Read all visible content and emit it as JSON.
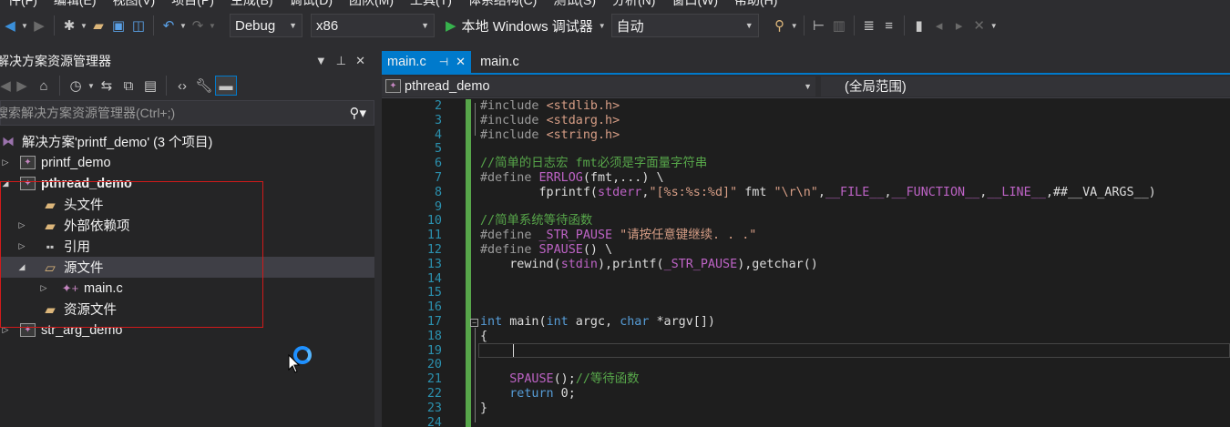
{
  "menu": [
    "件(F)",
    "编辑(E)",
    "视图(V)",
    "项目(P)",
    "生成(B)",
    "调试(D)",
    "团队(M)",
    "工具(T)",
    "体系结构(C)",
    "测试(S)",
    "分析(N)",
    "窗口(W)",
    "帮助(H)"
  ],
  "toolbar": {
    "config": "Debug",
    "platform": "x86",
    "debugger": "本地 Windows 调试器",
    "mode": "自动"
  },
  "solution_explorer": {
    "title": "解决方案资源管理器",
    "search_placeholder": "搜索解决方案资源管理器(Ctrl+;)",
    "tree": {
      "solution": "解决方案'printf_demo' (3 个项目)",
      "project1": "printf_demo",
      "project2": "pthread_demo",
      "headers": "头文件",
      "external": "外部依赖项",
      "refs": "引用",
      "sources": "源文件",
      "mainc": "main.c",
      "resources": "资源文件",
      "project3": "str_arg_demo"
    }
  },
  "editor": {
    "tabs": [
      "main.c",
      "main.c"
    ],
    "nav_project": "pthread_demo",
    "nav_scope": "(全局范围)",
    "line_numbers": [
      "2",
      "3",
      "4",
      "5",
      "6",
      "7",
      "8",
      "9",
      "10",
      "11",
      "12",
      "13",
      "14",
      "15",
      "16",
      "17",
      "18",
      "19",
      "20",
      "21",
      "22",
      "23",
      "24"
    ],
    "code": {
      "l2a": "#include ",
      "l2b": "<stdlib.h>",
      "l3a": "#include ",
      "l3b": "<stdarg.h>",
      "l4a": "#include ",
      "l4b": "<string.h>",
      "l6": "//简单的日志宏 fmt必须是字面量字符串",
      "l7a": "#define ",
      "l7b": "ERRLOG",
      "l7c": "(fmt,...) \\",
      "l8a": "        fprintf(",
      "l8b": "stderr",
      "l8c": ",",
      "l8d": "\"[%s:%s:%d]\"",
      "l8e": " fmt ",
      "l8f": "\"\\r\\n\"",
      "l8g": ",",
      "l8h": "__FILE__",
      "l8i": ",",
      "l8j": "__FUNCTION__",
      "l8k": ",",
      "l8l": "__LINE__",
      "l8m": ",##__VA_ARGS__)",
      "l10": "//简单系统等待函数",
      "l11a": "#define ",
      "l11b": "_STR_PAUSE",
      "l11c": " \"请按任意键继续. . .\"",
      "l12a": "#define ",
      "l12b": "SPAUSE",
      "l12c": "() \\",
      "l13a": "    rewind(",
      "l13b": "stdin",
      "l13c": "),printf(",
      "l13d": "_STR_PAUSE",
      "l13e": "),getchar()",
      "l17a": "int",
      "l17b": " main(",
      "l17c": "int",
      "l17d": " argc, ",
      "l17e": "char",
      "l17f": " *argv[])",
      "l18": "{",
      "l21a": "    ",
      "l21b": "SPAUSE",
      "l21c": "();",
      "l21d": "//等待函数",
      "l22a": "    ",
      "l22b": "return",
      "l22c": " 0;",
      "l23": "}"
    }
  },
  "colors": {
    "accent": "#007acc",
    "line_number": "#2b91af",
    "comment": "#57a64a",
    "keyword": "#569cd6",
    "macro": "#bd63c5",
    "string": "#d69d85",
    "highlight_box": "#d11a1a"
  }
}
